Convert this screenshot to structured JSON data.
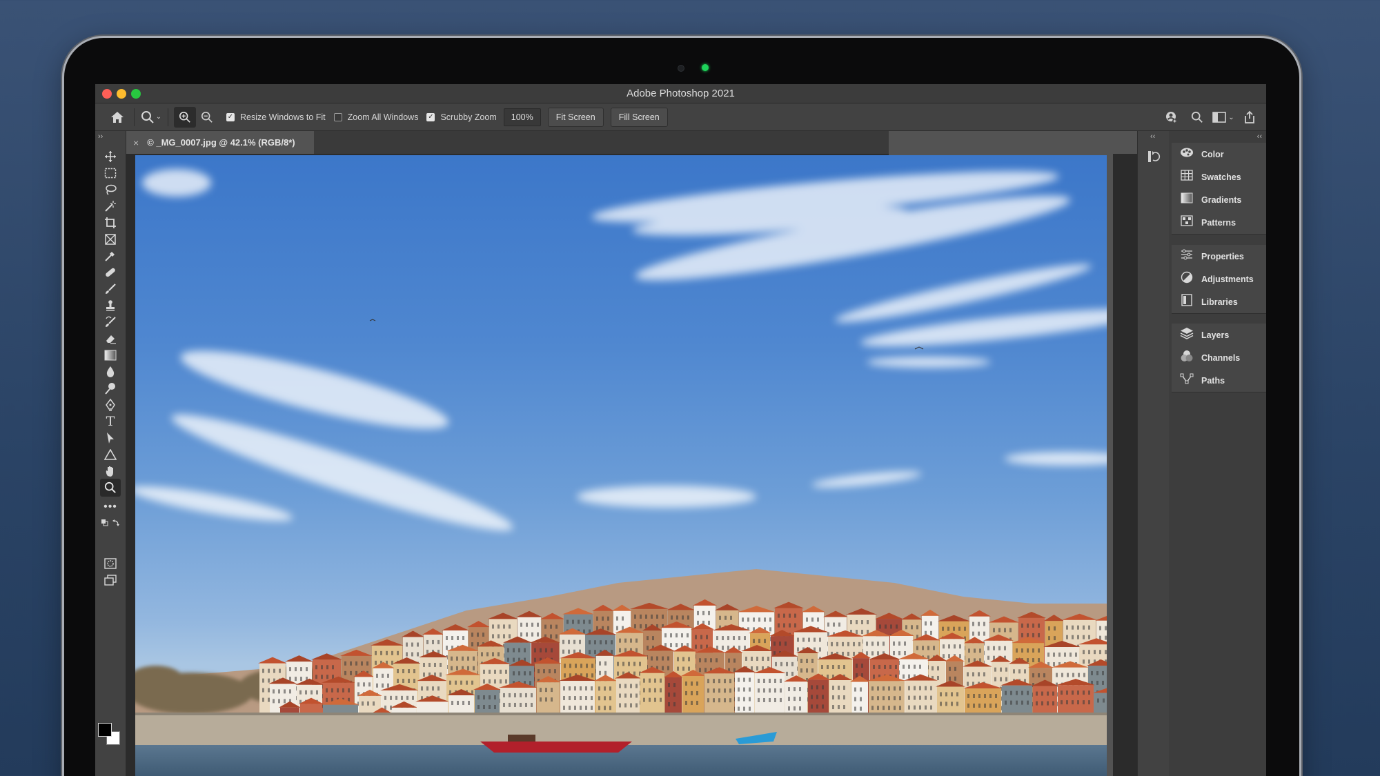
{
  "window": {
    "title": "Adobe Photoshop 2021"
  },
  "options_bar": {
    "zoom_value": "100%",
    "resize_windows_label": "Resize Windows to Fit",
    "resize_windows_checked": true,
    "zoom_all_label": "Zoom All Windows",
    "zoom_all_checked": false,
    "scrubby_label": "Scrubby Zoom",
    "scrubby_checked": true,
    "fit_screen_label": "Fit Screen",
    "fill_screen_label": "Fill Screen"
  },
  "document_tab": {
    "title": "© _MG_0007.jpg @ 42.1% (RGB/8*)",
    "close": "×"
  },
  "panels": {
    "group1": [
      {
        "label": "Color",
        "icon": "color-wheel-icon"
      },
      {
        "label": "Swatches",
        "icon": "grid-icon"
      },
      {
        "label": "Gradients",
        "icon": "gradient-icon"
      },
      {
        "label": "Patterns",
        "icon": "pattern-icon"
      }
    ],
    "group2": [
      {
        "label": "Properties",
        "icon": "sliders-icon"
      },
      {
        "label": "Adjustments",
        "icon": "adjust-icon"
      },
      {
        "label": "Libraries",
        "icon": "library-icon"
      }
    ],
    "group3": [
      {
        "label": "Layers",
        "icon": "layers-icon"
      },
      {
        "label": "Channels",
        "icon": "channels-icon"
      },
      {
        "label": "Paths",
        "icon": "paths-icon"
      }
    ]
  }
}
